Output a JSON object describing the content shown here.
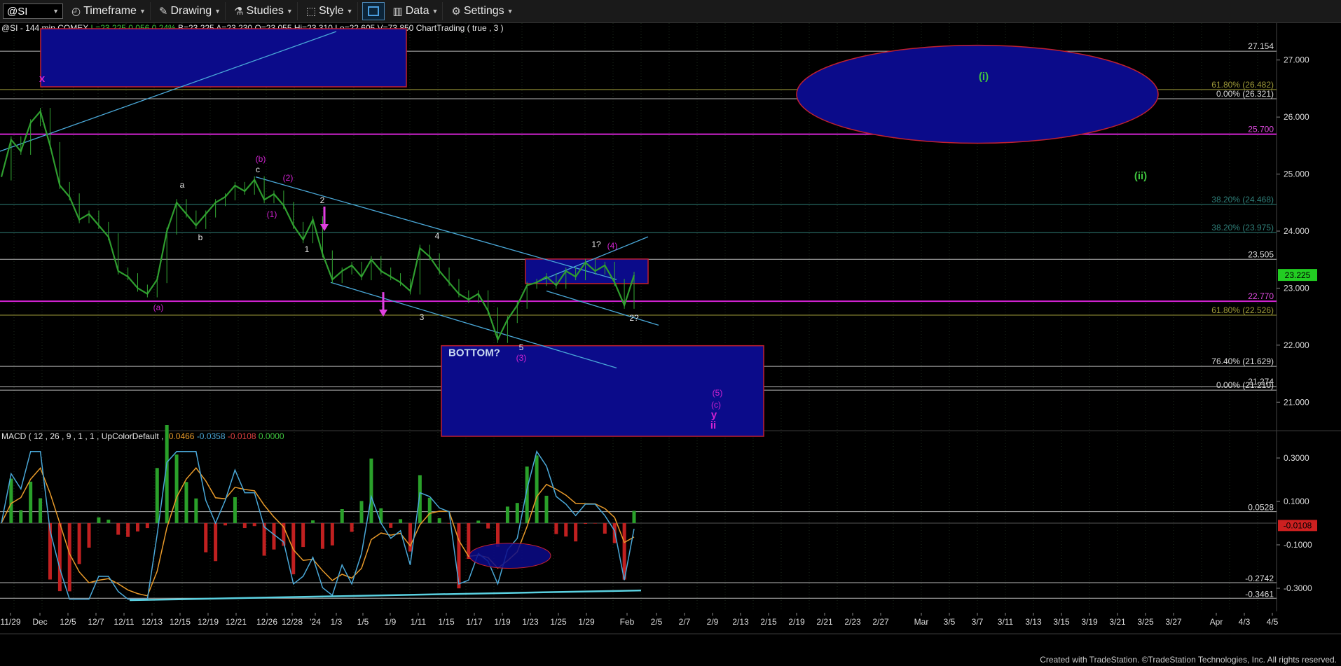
{
  "toolbar": {
    "symbol": "@SI",
    "timeframe": "Timeframe",
    "drawing": "Drawing",
    "studies": "Studies",
    "style": "Style",
    "data": "Data",
    "settings": "Settings"
  },
  "header": {
    "symbol_desc": "@SI - 144 min  COMEX",
    "last": "L=23.225",
    "change": "0.056",
    "pct": "0.24%",
    "bid": "B=23.225",
    "ask": "A=23.230",
    "open": "O=23.055",
    "high": "Hi=23.310",
    "low": "Lo=22.605",
    "volume": "V=73,850",
    "charttrading": "ChartTrading ( true , 3 )"
  },
  "macd_header": {
    "label": "MACD ( 12 , 26 , 9 , 1 , 1 , UpColorDefault , ",
    "v1": "-0.0466",
    "v2": "-0.0358",
    "v3": "-0.0108",
    "v4": "0.0000"
  },
  "footer": "Created with TradeStation. ©TradeStation Technologies, Inc. All rights reserved.",
  "chart_data": {
    "type": "line",
    "price_axis": {
      "min": 20.5,
      "max": 27.5,
      "ticks": [
        21.0,
        22.0,
        23.0,
        24.0,
        25.0,
        26.0,
        27.0
      ]
    },
    "last_price": "23.225",
    "x_labels": [
      "11/29",
      "Dec",
      "12/5",
      "12/7",
      "12/11",
      "12/13",
      "12/15",
      "12/19",
      "12/21",
      "12/26",
      "12/28",
      "'24",
      "1/3",
      "1/5",
      "1/9",
      "1/11",
      "1/15",
      "1/17",
      "1/19",
      "1/23",
      "1/25",
      "1/29",
      "Feb",
      "2/5",
      "2/7",
      "2/9",
      "2/13",
      "2/15",
      "2/19",
      "2/21",
      "2/23",
      "2/27",
      "Mar",
      "3/5",
      "3/7",
      "3/11",
      "3/13",
      "3/15",
      "3/19",
      "3/21",
      "3/25",
      "3/27",
      "Apr",
      "4/3",
      "4/5"
    ],
    "series": [
      {
        "values": [
          [
            0,
            24.95
          ],
          [
            1,
            25.6
          ],
          [
            2,
            25.4
          ],
          [
            3,
            25.9
          ],
          [
            4,
            26.1
          ],
          [
            5,
            25.5
          ],
          [
            6,
            24.8
          ],
          [
            7,
            24.6
          ],
          [
            8,
            24.2
          ],
          [
            9,
            24.3
          ],
          [
            10,
            24.1
          ],
          [
            11,
            23.9
          ],
          [
            12,
            23.3
          ],
          [
            13,
            23.2
          ],
          [
            14,
            23.0
          ],
          [
            15,
            22.9
          ],
          [
            16,
            23.15
          ],
          [
            17,
            24.0
          ],
          [
            18,
            24.5
          ],
          [
            19,
            24.3
          ],
          [
            20,
            24.1
          ],
          [
            21,
            24.3
          ],
          [
            22,
            24.5
          ],
          [
            23,
            24.6
          ],
          [
            24,
            24.8
          ],
          [
            25,
            24.7
          ],
          [
            26,
            24.9
          ],
          [
            27,
            24.55
          ],
          [
            28,
            24.65
          ],
          [
            29,
            24.45
          ],
          [
            30,
            24.1
          ],
          [
            31,
            23.85
          ],
          [
            32,
            24.2
          ],
          [
            33,
            23.6
          ],
          [
            34,
            23.15
          ],
          [
            35,
            23.3
          ],
          [
            36,
            23.4
          ],
          [
            37,
            23.2
          ],
          [
            38,
            23.5
          ],
          [
            39,
            23.3
          ],
          [
            40,
            23.2
          ],
          [
            41,
            23.1
          ],
          [
            42,
            22.95
          ],
          [
            43,
            23.7
          ],
          [
            44,
            23.55
          ],
          [
            45,
            23.3
          ],
          [
            46,
            23.1
          ],
          [
            47,
            22.9
          ],
          [
            48,
            22.8
          ],
          [
            49,
            22.9
          ],
          [
            50,
            22.6
          ],
          [
            51,
            22.1
          ],
          [
            52,
            22.45
          ],
          [
            53,
            22.7
          ],
          [
            54,
            23.05
          ],
          [
            55,
            23.1
          ],
          [
            56,
            23.2
          ],
          [
            57,
            23.05
          ],
          [
            58,
            23.3
          ],
          [
            59,
            23.2
          ],
          [
            60,
            23.45
          ],
          [
            61,
            23.3
          ],
          [
            62,
            23.4
          ],
          [
            63,
            23.1
          ],
          [
            64,
            22.7
          ],
          [
            65,
            23.225
          ]
        ]
      }
    ],
    "horizontal_levels": [
      {
        "label": "27.154",
        "value": 27.154,
        "color": "#b8b8b8"
      },
      {
        "label": "61.80% (26.482)",
        "value": 26.482,
        "color": "#9e9a38"
      },
      {
        "label": "0.00% (26.321)",
        "value": 26.321,
        "color": "#b8b8b8"
      },
      {
        "label": "25.700",
        "value": 25.7,
        "color": "#d223d2"
      },
      {
        "label": "38.20% (24.468)",
        "value": 24.468,
        "color": "#2f7f79"
      },
      {
        "label": "38.20% (23.975)",
        "value": 23.975,
        "color": "#2f7f79"
      },
      {
        "label": "23.505",
        "value": 23.505,
        "color": "#b8b8b8"
      },
      {
        "label": "22.770",
        "value": 22.77,
        "color": "#d223d2"
      },
      {
        "label": "61.80% (22.526)",
        "value": 22.526,
        "color": "#9e9a38"
      },
      {
        "label": "76.40% (21.629)",
        "value": 21.629,
        "color": "#b8b8b8"
      },
      {
        "label": "21.274",
        "value": 21.274,
        "color": "#b8b8b8"
      },
      {
        "label": "0.00% (21.210)",
        "value": 21.21,
        "color": "#b8b8b8"
      }
    ],
    "wave_labels": [
      {
        "text": "x",
        "color": "#d223d2"
      },
      {
        "text": "(b)",
        "color": "#d223d2"
      },
      {
        "text": "c",
        "color": "#e6e6e6"
      },
      {
        "text": "a",
        "color": "#e6e6e6"
      },
      {
        "text": "b",
        "color": "#e6e6e6"
      },
      {
        "text": "(a)",
        "color": "#d223d2"
      },
      {
        "text": "(2)",
        "color": "#d223d2"
      },
      {
        "text": "(1)",
        "color": "#d223d2"
      },
      {
        "text": "2",
        "color": "#e6e6e6"
      },
      {
        "text": "1",
        "color": "#e6e6e6"
      },
      {
        "text": "4",
        "color": "#e6e6e6"
      },
      {
        "text": "3",
        "color": "#e6e6e6"
      },
      {
        "text": "5",
        "color": "#e6e6e6"
      },
      {
        "text": "(3)",
        "color": "#d223d2"
      },
      {
        "text": "1?",
        "color": "#e6e6e6"
      },
      {
        "text": "(4)",
        "color": "#d223d2"
      },
      {
        "text": "2?",
        "color": "#e6e6e6"
      },
      {
        "text": "(5)",
        "color": "#d223d2"
      },
      {
        "text": "(c)",
        "color": "#d223d2"
      },
      {
        "text": "y",
        "color": "#d223d2"
      },
      {
        "text": "ii",
        "color": "#d223d2"
      },
      {
        "text": "(i)",
        "color": "#3fc43f"
      },
      {
        "text": "(ii)",
        "color": "#3fc43f"
      }
    ],
    "annotation": "BOTTOM?",
    "macd_axis": {
      "ticks": [
        "0.3000",
        "0.1000",
        "-0.1000",
        "-0.3000"
      ],
      "levels": [
        "0.0528",
        "-0.2742",
        "-0.3461"
      ],
      "current": "-0.0108"
    }
  }
}
